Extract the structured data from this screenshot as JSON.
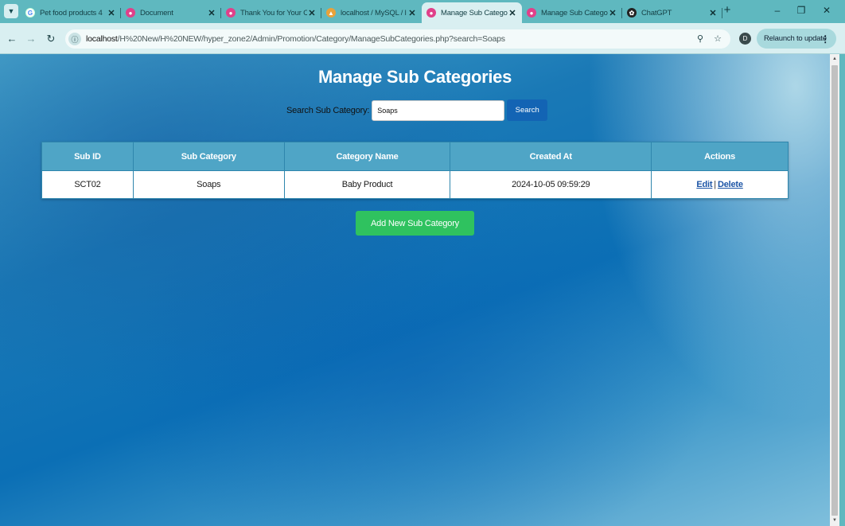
{
  "browser": {
    "tabs": [
      {
        "title": "Pet food products 4",
        "icon": "google-icon"
      },
      {
        "title": "Document",
        "icon": "pink-circle-icon"
      },
      {
        "title": "Thank You for Your C",
        "icon": "pink-circle-icon"
      },
      {
        "title": "localhost / MySQL / l",
        "icon": "phpmyadmin-icon"
      },
      {
        "title": "Manage Sub Catego",
        "icon": "pink-circle-icon",
        "active": true
      },
      {
        "title": "Manage Sub Catego",
        "icon": "pink-circle-icon"
      },
      {
        "title": "ChatGPT",
        "icon": "chatgpt-icon"
      }
    ],
    "address": {
      "host": "localhost",
      "path": "/H%20New/H%20NEW/hyper_zone2/Admin/Promotion/Category/ManageSubCategories.php?search=Soaps"
    },
    "profile_initial": "D",
    "relaunch_label": "Relaunch to update"
  },
  "page": {
    "title": "Manage Sub Categories",
    "search": {
      "label": "Search Sub Category:",
      "value": "Soaps",
      "button_label": "Search"
    },
    "table": {
      "headers": [
        "Sub ID",
        "Sub Category",
        "Category Name",
        "Created At",
        "Actions"
      ],
      "rows": [
        {
          "sub_id": "SCT02",
          "sub_category": "Soaps",
          "category_name": "Baby Product",
          "created_at": "2024-10-05 09:59:29",
          "edit_label": "Edit",
          "separator": "|",
          "delete_label": "Delete"
        }
      ]
    },
    "add_button_label": "Add New Sub Category"
  },
  "colors": {
    "header_bg": "#4fa5c6",
    "search_button": "#1364b4",
    "add_button": "#2fc25f",
    "link": "#1d55a6"
  }
}
